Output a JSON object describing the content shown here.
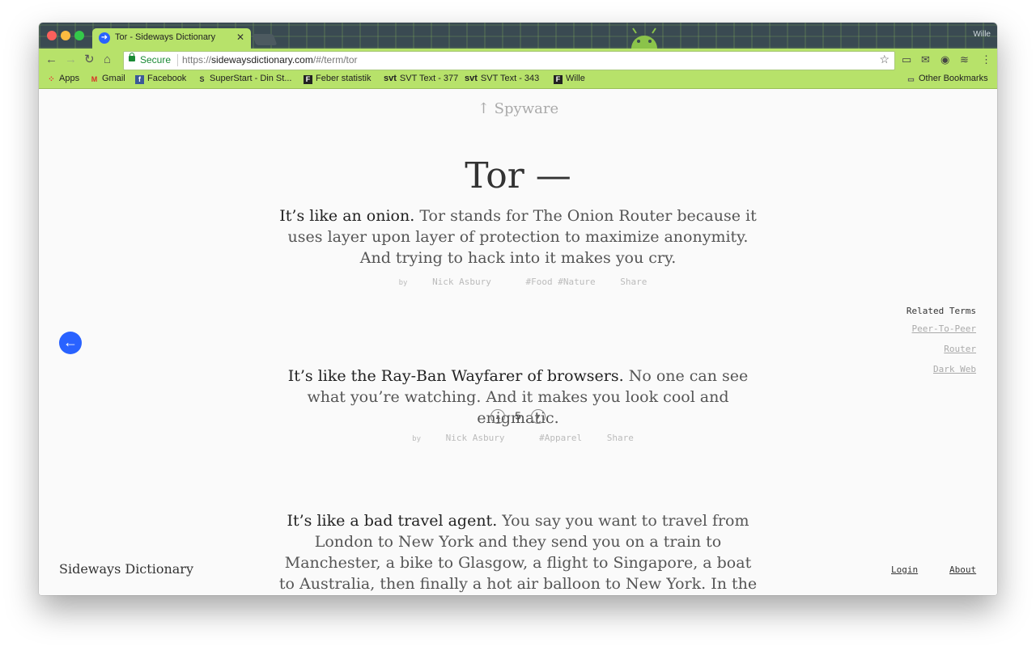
{
  "browser": {
    "tab_title": "Tor - Sideways Dictionary",
    "tab_close": "✕",
    "profile_name": "Wille",
    "security_label": "Secure",
    "url_scheme": "https://",
    "url_host": "sidewaysdictionary.com",
    "url_path": "/#/term/tor",
    "bookmarks": [
      "Apps",
      "Gmail",
      "Facebook",
      "SuperStart - Din St...",
      "Feber statistik",
      "SVT Text - 377",
      "SVT Text - 343",
      "Wille"
    ],
    "bookmark_prefix_svt": "svt",
    "other_bookmarks": "Other Bookmarks"
  },
  "page": {
    "parent_term": "↑ Spyware",
    "term_title": "Tor —",
    "definitions": [
      {
        "lead": "It’s like an onion.",
        "body": " Tor stands for The Onion Router because it uses layer upon layer of protection to maximize anonymity. And trying to hack into it makes you cry.",
        "by": "by",
        "author": "Nick Asbury",
        "tags": "#Food #Nature",
        "share": "Share"
      },
      {
        "lead": "It’s like the Ray-Ban Wayfarer of browsers.",
        "body": " No one can see what you’re watching. And it makes you look cool and enigmatic.",
        "votes": "5",
        "by": "by",
        "author": "Nick Asbury",
        "tags": "#Apparel",
        "share": "Share"
      },
      {
        "lead": "It’s like a bad travel agent.",
        "body": " You say you want to travel from London to New York and they send you on a train to Manchester, a bike to Glasgow, a flight to Singapore, a boat to Australia, then finally a hot air balloon to New York. In the same way, Tor bounces you around the"
      }
    ],
    "related_heading": "Related Terms",
    "related_terms": [
      "Peer-To-Peer",
      "Router",
      "Dark Web"
    ],
    "brand": "Sideways Dictionary",
    "login": "Login",
    "about": "About"
  },
  "colors": {
    "accent": "#2962ff",
    "chrome_green": "#b7e26a"
  }
}
